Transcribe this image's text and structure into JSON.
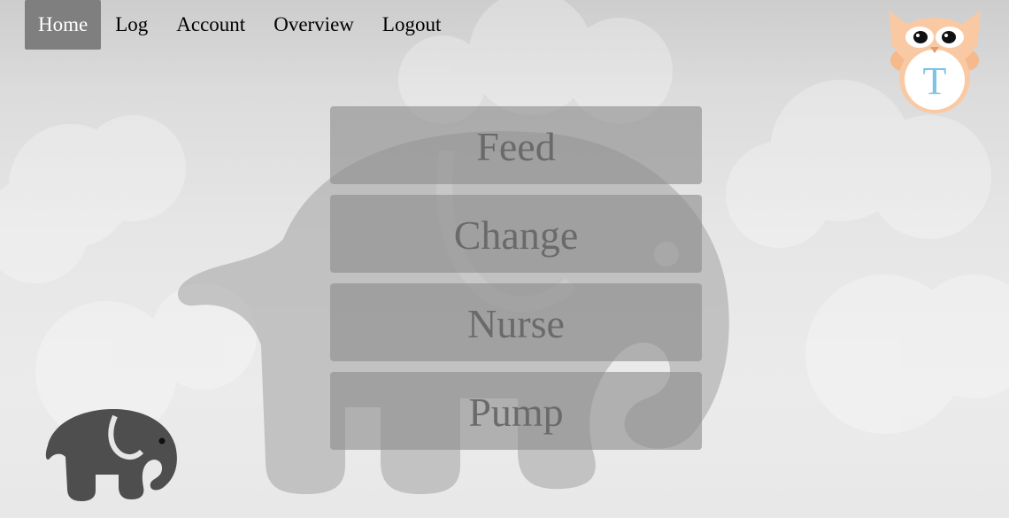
{
  "nav": {
    "items": [
      {
        "label": "Home",
        "active": true
      },
      {
        "label": "Log",
        "active": false
      },
      {
        "label": "Account",
        "active": false
      },
      {
        "label": "Overview",
        "active": false
      },
      {
        "label": "Logout",
        "active": false
      }
    ]
  },
  "badge": {
    "icon": "owl-icon",
    "initial": "T"
  },
  "menu": {
    "buttons": [
      {
        "label": "Feed"
      },
      {
        "label": "Change"
      },
      {
        "label": "Nurse"
      },
      {
        "label": "Pump"
      }
    ]
  },
  "decor": {
    "background_icon": "elephant-icon",
    "corner_icon": "elephant-icon"
  },
  "colors": {
    "active_nav": "#7f7f7f",
    "menu_button": "#8c8c8c",
    "menu_text": "#6a6a6a",
    "owl_body": "#f9c9a4",
    "owl_initial": "#7ec4e4",
    "elephant_dark": "#4e4e4e"
  }
}
